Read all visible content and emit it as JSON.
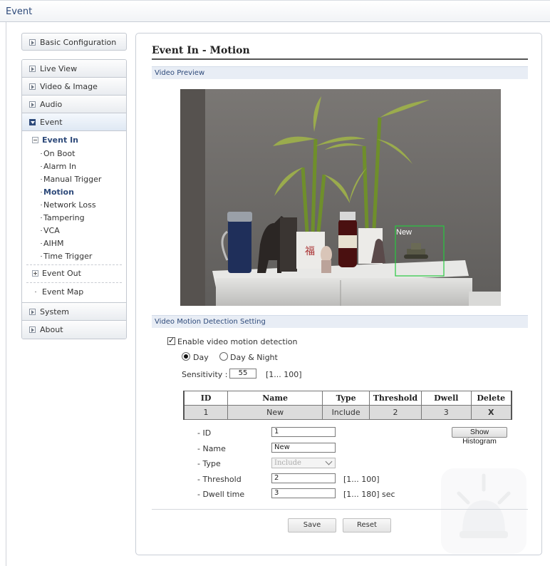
{
  "topbar": {
    "title": "Event"
  },
  "sidebar": {
    "basic_config": "Basic Configuration",
    "live_view": "Live View",
    "video_image": "Video & Image",
    "audio": "Audio",
    "event": "Event",
    "event_in": "Event In",
    "event_in_items": [
      "On Boot",
      "Alarm In",
      "Manual Trigger",
      "Motion",
      "Network Loss",
      "Tampering",
      "VCA",
      "AIHM",
      "Time Trigger"
    ],
    "current_item": "Motion",
    "event_out": "Event Out",
    "event_map": "Event Map",
    "system": "System",
    "about": "About"
  },
  "main": {
    "title": "Event In - Motion",
    "video_preview_label": "Video Preview",
    "overlay_zone_label": "New",
    "detection_section_label": "Video Motion Detection Setting",
    "enable_label": "Enable video motion detection",
    "enable_checked": true,
    "mode_options": [
      "Day",
      "Day & Night"
    ],
    "mode_selected": "Day",
    "sensitivity_label": "Sensitivity :",
    "sensitivity_value": "55",
    "sensitivity_range": "[1... 100]",
    "table": {
      "headers": [
        "ID",
        "Name",
        "Type",
        "Threshold",
        "Dwell",
        "Delete"
      ],
      "rows": [
        [
          "1",
          "New",
          "Include",
          "2",
          "3",
          "X"
        ]
      ]
    },
    "form": {
      "id_label": "- ID",
      "id_value": "1",
      "name_label": "- Name",
      "name_value": "New",
      "type_label": "- Type",
      "type_value": "Include",
      "threshold_label": "- Threshold",
      "threshold_value": "2",
      "threshold_range": "[1... 100]",
      "dwell_label": "- Dwell time",
      "dwell_value": "3",
      "dwell_range": "[1... 180] sec",
      "histogram_button": "Show Histogram"
    },
    "save_button": "Save",
    "reset_button": "Reset"
  },
  "colors": {
    "accent": "#2e4a7a",
    "section_bg": "#e8edf5",
    "zone_box": "#27c93f"
  }
}
